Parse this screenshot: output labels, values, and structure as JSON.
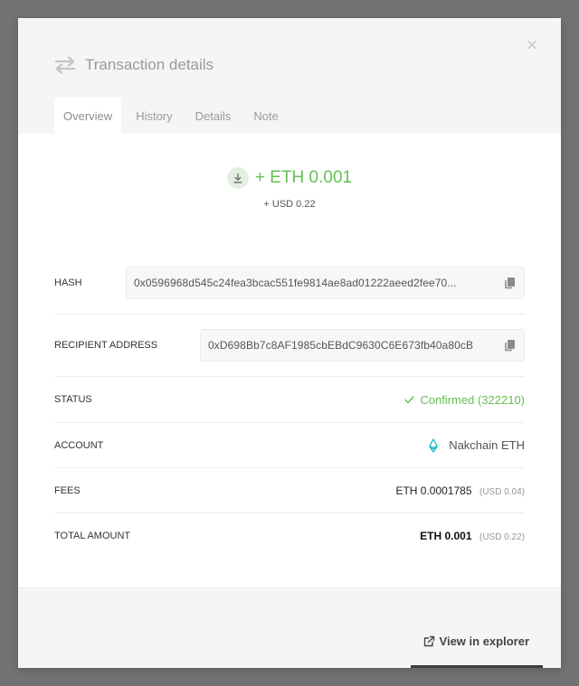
{
  "header": {
    "title": "Transaction details",
    "close_label": "×"
  },
  "tabs": [
    {
      "label": "Overview",
      "active": true
    },
    {
      "label": "History",
      "active": false
    },
    {
      "label": "Details",
      "active": false
    },
    {
      "label": "Note",
      "active": false
    }
  ],
  "amount": {
    "value": "+ ETH 0.001",
    "usd": "+ USD 0.22",
    "direction_icon": "download-arrow-icon"
  },
  "details": {
    "hash": {
      "label": "HASH",
      "value": "0x0596968d545c24fea3bcac551fe9814ae8ad01222aeed2fee70..."
    },
    "recipient": {
      "label": "RECIPIENT ADDRESS",
      "value": "0xD698Bb7c8AF1985cbEBdC9630C6E673fb40a80cB"
    },
    "status": {
      "label": "STATUS",
      "value": "Confirmed (322210)"
    },
    "account": {
      "label": "ACCOUNT",
      "value": "Nakchain ETH",
      "icon": "ethereum-icon"
    },
    "fees": {
      "label": "FEES",
      "value": "ETH 0.0001785",
      "usd": "(USD 0.04)"
    },
    "total": {
      "label": "TOTAL AMOUNT",
      "value": "ETH 0.001",
      "usd": "(USD 0.22)"
    }
  },
  "footer": {
    "view_explorer_label": "View in explorer"
  },
  "colors": {
    "accent_green": "#66be54",
    "eth_icon": "#2bb9c9",
    "overlay": "#727272"
  }
}
